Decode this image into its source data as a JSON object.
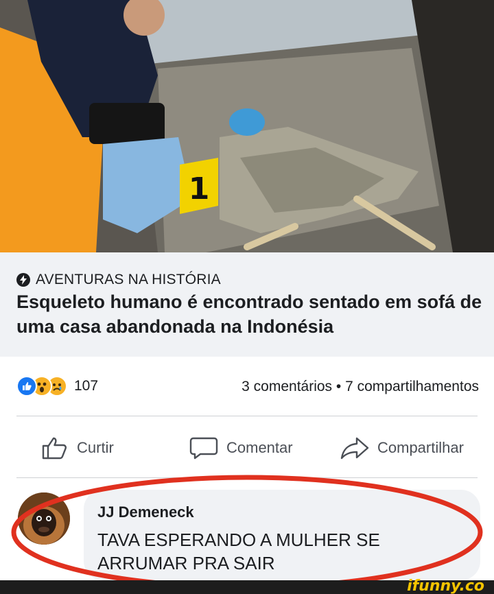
{
  "post": {
    "source": "AVENTURAS NA HISTÓRIA",
    "headline": "Esqueleto humano é encontrado sentado em sofá de uma casa abandonada na Indonésia",
    "evidence_marker": "1"
  },
  "stats": {
    "reaction_count": "107",
    "comments_shares": "3 comentários • 7 compartilhamentos"
  },
  "actions": {
    "like": "Curtir",
    "comment": "Comentar",
    "share": "Compartilhar"
  },
  "comment": {
    "author": "JJ Demeneck",
    "text": "TAVA ESPERANDO A MULHER SE ARRUMAR PRA SAIR"
  },
  "footer": {
    "brand": "ifunny.co"
  },
  "colors": {
    "link_box_bg": "#f0f2f5",
    "like_blue": "#1877f2",
    "highlight_red": "#e0311f",
    "brand_yellow": "#f5c400"
  }
}
